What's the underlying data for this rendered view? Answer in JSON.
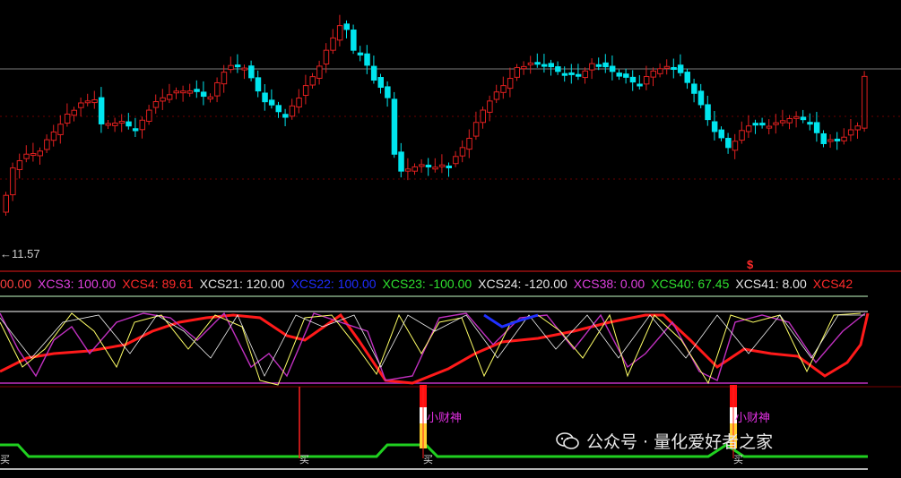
{
  "price_marker": "←11.57",
  "signal_mark": "$",
  "indicator_bar": [
    {
      "label": "00.00",
      "color": "#ff4040"
    },
    {
      "label": "XCS3: 100.00",
      "color": "#e040e0"
    },
    {
      "label": "XCS4: 89.61",
      "color": "#ff2a2a"
    },
    {
      "label": "XCS21: 120.00",
      "color": "#e6e6e6"
    },
    {
      "label": "XCS22: 100.00",
      "color": "#1f2cff"
    },
    {
      "label": "XCS23: -100.00",
      "color": "#2fe02f"
    },
    {
      "label": "XCS24: -120.00",
      "color": "#e6e6e6"
    },
    {
      "label": "XCS38: 0.00",
      "color": "#e040e0"
    },
    {
      "label": "XCS40: 67.45",
      "color": "#2fe02f"
    },
    {
      "label": "XCS41: 8.00",
      "color": "#e6e6e6"
    },
    {
      "label": "XCS42",
      "color": "#ff2a2a"
    }
  ],
  "signals": {
    "xiaocaishen": "小财神",
    "buy": "买"
  },
  "watermark": "公众号 · 量化爱好者之家",
  "colors": {
    "up": "#e02020",
    "down": "#00e5ee",
    "red_line": "#ff1a1a",
    "green_line": "#20d020",
    "purple": "#c030c0",
    "yellow": "#ffff66"
  }
}
